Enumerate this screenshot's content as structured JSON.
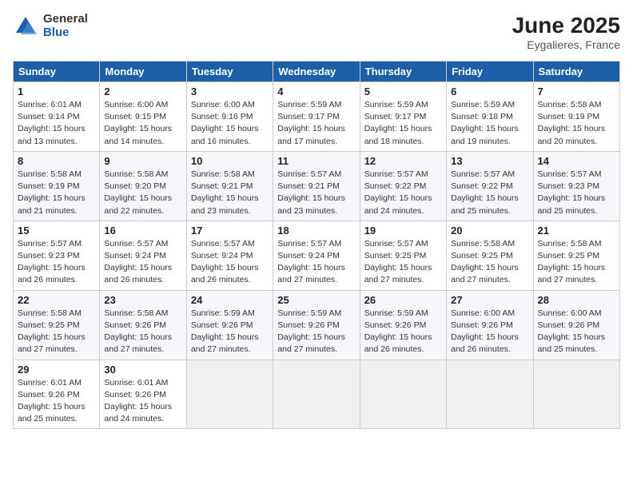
{
  "logo": {
    "general": "General",
    "blue": "Blue"
  },
  "title": {
    "month": "June 2025",
    "location": "Eygalieres, France"
  },
  "calendar": {
    "headers": [
      "Sunday",
      "Monday",
      "Tuesday",
      "Wednesday",
      "Thursday",
      "Friday",
      "Saturday"
    ],
    "weeks": [
      [
        {
          "day": 1,
          "sunrise": "Sunrise: 6:01 AM",
          "sunset": "Sunset: 9:14 PM",
          "daylight": "Daylight: 15 hours and 13 minutes."
        },
        {
          "day": 2,
          "sunrise": "Sunrise: 6:00 AM",
          "sunset": "Sunset: 9:15 PM",
          "daylight": "Daylight: 15 hours and 14 minutes."
        },
        {
          "day": 3,
          "sunrise": "Sunrise: 6:00 AM",
          "sunset": "Sunset: 9:16 PM",
          "daylight": "Daylight: 15 hours and 16 minutes."
        },
        {
          "day": 4,
          "sunrise": "Sunrise: 5:59 AM",
          "sunset": "Sunset: 9:17 PM",
          "daylight": "Daylight: 15 hours and 17 minutes."
        },
        {
          "day": 5,
          "sunrise": "Sunrise: 5:59 AM",
          "sunset": "Sunset: 9:17 PM",
          "daylight": "Daylight: 15 hours and 18 minutes."
        },
        {
          "day": 6,
          "sunrise": "Sunrise: 5:59 AM",
          "sunset": "Sunset: 9:18 PM",
          "daylight": "Daylight: 15 hours and 19 minutes."
        },
        {
          "day": 7,
          "sunrise": "Sunrise: 5:58 AM",
          "sunset": "Sunset: 9:19 PM",
          "daylight": "Daylight: 15 hours and 20 minutes."
        }
      ],
      [
        {
          "day": 8,
          "sunrise": "Sunrise: 5:58 AM",
          "sunset": "Sunset: 9:19 PM",
          "daylight": "Daylight: 15 hours and 21 minutes."
        },
        {
          "day": 9,
          "sunrise": "Sunrise: 5:58 AM",
          "sunset": "Sunset: 9:20 PM",
          "daylight": "Daylight: 15 hours and 22 minutes."
        },
        {
          "day": 10,
          "sunrise": "Sunrise: 5:58 AM",
          "sunset": "Sunset: 9:21 PM",
          "daylight": "Daylight: 15 hours and 23 minutes."
        },
        {
          "day": 11,
          "sunrise": "Sunrise: 5:57 AM",
          "sunset": "Sunset: 9:21 PM",
          "daylight": "Daylight: 15 hours and 23 minutes."
        },
        {
          "day": 12,
          "sunrise": "Sunrise: 5:57 AM",
          "sunset": "Sunset: 9:22 PM",
          "daylight": "Daylight: 15 hours and 24 minutes."
        },
        {
          "day": 13,
          "sunrise": "Sunrise: 5:57 AM",
          "sunset": "Sunset: 9:22 PM",
          "daylight": "Daylight: 15 hours and 25 minutes."
        },
        {
          "day": 14,
          "sunrise": "Sunrise: 5:57 AM",
          "sunset": "Sunset: 9:23 PM",
          "daylight": "Daylight: 15 hours and 25 minutes."
        }
      ],
      [
        {
          "day": 15,
          "sunrise": "Sunrise: 5:57 AM",
          "sunset": "Sunset: 9:23 PM",
          "daylight": "Daylight: 15 hours and 26 minutes."
        },
        {
          "day": 16,
          "sunrise": "Sunrise: 5:57 AM",
          "sunset": "Sunset: 9:24 PM",
          "daylight": "Daylight: 15 hours and 26 minutes."
        },
        {
          "day": 17,
          "sunrise": "Sunrise: 5:57 AM",
          "sunset": "Sunset: 9:24 PM",
          "daylight": "Daylight: 15 hours and 26 minutes."
        },
        {
          "day": 18,
          "sunrise": "Sunrise: 5:57 AM",
          "sunset": "Sunset: 9:24 PM",
          "daylight": "Daylight: 15 hours and 27 minutes."
        },
        {
          "day": 19,
          "sunrise": "Sunrise: 5:57 AM",
          "sunset": "Sunset: 9:25 PM",
          "daylight": "Daylight: 15 hours and 27 minutes."
        },
        {
          "day": 20,
          "sunrise": "Sunrise: 5:58 AM",
          "sunset": "Sunset: 9:25 PM",
          "daylight": "Daylight: 15 hours and 27 minutes."
        },
        {
          "day": 21,
          "sunrise": "Sunrise: 5:58 AM",
          "sunset": "Sunset: 9:25 PM",
          "daylight": "Daylight: 15 hours and 27 minutes."
        }
      ],
      [
        {
          "day": 22,
          "sunrise": "Sunrise: 5:58 AM",
          "sunset": "Sunset: 9:25 PM",
          "daylight": "Daylight: 15 hours and 27 minutes."
        },
        {
          "day": 23,
          "sunrise": "Sunrise: 5:58 AM",
          "sunset": "Sunset: 9:26 PM",
          "daylight": "Daylight: 15 hours and 27 minutes."
        },
        {
          "day": 24,
          "sunrise": "Sunrise: 5:59 AM",
          "sunset": "Sunset: 9:26 PM",
          "daylight": "Daylight: 15 hours and 27 minutes."
        },
        {
          "day": 25,
          "sunrise": "Sunrise: 5:59 AM",
          "sunset": "Sunset: 9:26 PM",
          "daylight": "Daylight: 15 hours and 27 minutes."
        },
        {
          "day": 26,
          "sunrise": "Sunrise: 5:59 AM",
          "sunset": "Sunset: 9:26 PM",
          "daylight": "Daylight: 15 hours and 26 minutes."
        },
        {
          "day": 27,
          "sunrise": "Sunrise: 6:00 AM",
          "sunset": "Sunset: 9:26 PM",
          "daylight": "Daylight: 15 hours and 26 minutes."
        },
        {
          "day": 28,
          "sunrise": "Sunrise: 6:00 AM",
          "sunset": "Sunset: 9:26 PM",
          "daylight": "Daylight: 15 hours and 25 minutes."
        }
      ],
      [
        {
          "day": 29,
          "sunrise": "Sunrise: 6:01 AM",
          "sunset": "Sunset: 9:26 PM",
          "daylight": "Daylight: 15 hours and 25 minutes."
        },
        {
          "day": 30,
          "sunrise": "Sunrise: 6:01 AM",
          "sunset": "Sunset: 9:26 PM",
          "daylight": "Daylight: 15 hours and 24 minutes."
        },
        null,
        null,
        null,
        null,
        null
      ]
    ]
  }
}
